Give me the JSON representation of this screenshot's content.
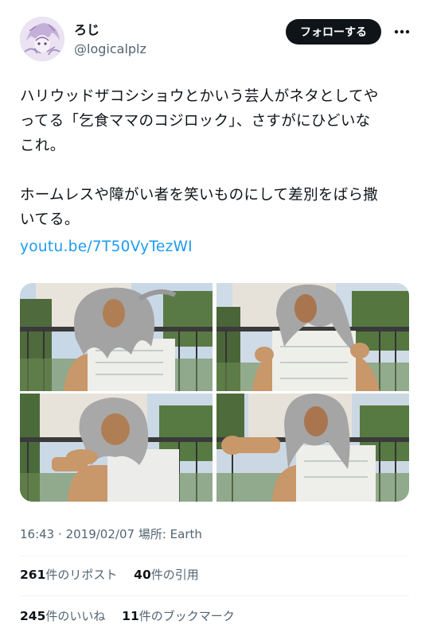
{
  "user": {
    "display_name": "ろじ",
    "handle": "@logicalplz",
    "follow_label": "フォローする"
  },
  "tweet": {
    "lines": [
      "ハリウッドザコシショウとかいう芸人がネタとしてや",
      "ってる「乞食ママのコジロック」、さすがにひどいな",
      "これ。",
      "",
      "ホームレスや障がい者を笑いものにして差別をばら撒",
      "いてる。"
    ],
    "link": "youtu.be/7T50VyTezWI"
  },
  "media": [
    {
      "description": "frame-1"
    },
    {
      "description": "frame-2"
    },
    {
      "description": "frame-3"
    },
    {
      "description": "frame-4"
    }
  ],
  "meta": {
    "time": "16:43",
    "date": "2019/02/07",
    "place_label": "場所: Earth",
    "separator": "·"
  },
  "stats": {
    "retweets_count": "261",
    "retweets_label": "件のリポスト",
    "quotes_count": "40",
    "quotes_label": "件の引用",
    "likes_count": "245",
    "likes_label": "件のいいね",
    "bookmarks_count": "11",
    "bookmarks_label": "件のブックマーク"
  },
  "icons": {
    "more": "more-dots-icon"
  },
  "colors": {
    "link": "#1d9bf0",
    "secondary_text": "#536471",
    "follow_button_bg": "#0f1419"
  }
}
